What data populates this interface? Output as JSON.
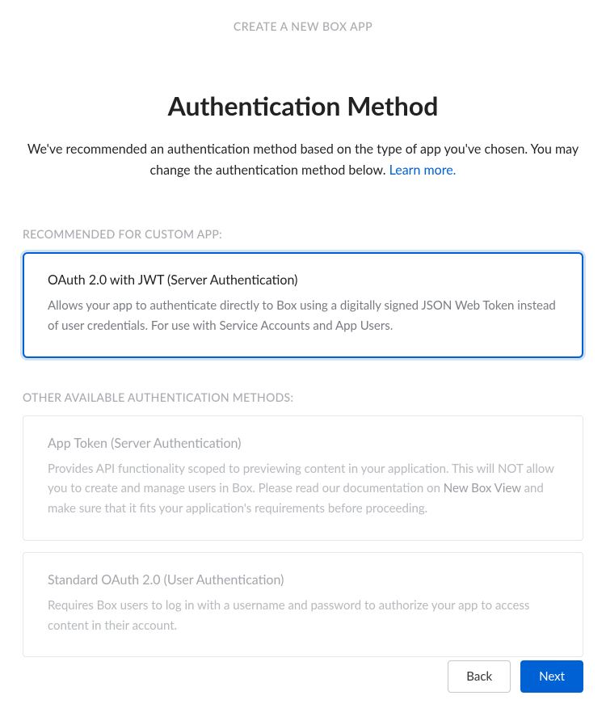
{
  "header": {
    "label": "CREATE A NEW BOX APP"
  },
  "title": "Authentication Method",
  "subtitle": {
    "text": "We've recommended an authentication method based on the type of app you've chosen. You may change the authentication method below. ",
    "link": "Learn more."
  },
  "sections": {
    "recommended_label": "RECOMMENDED FOR CUSTOM APP:",
    "other_label": "OTHER AVAILABLE AUTHENTICATION METHODS:"
  },
  "options": {
    "jwt": {
      "title": "OAuth 2.0 with JWT (Server Authentication)",
      "desc": "Allows your app to authenticate directly to Box using a digitally signed JSON Web Token instead of user credentials. For use with Service Accounts and App Users."
    },
    "app_token": {
      "title": "App Token (Server Authentication)",
      "desc_pre": "Provides API functionality scoped to previewing content in your application. This will NOT allow you to create and manage users in Box. Please read our documentation on ",
      "desc_link": "New Box View",
      "desc_post": " and make sure that it fits your application's requirements before proceeding."
    },
    "oauth": {
      "title": "Standard OAuth 2.0 (User Authentication)",
      "desc": "Requires Box users to log in with a username and password to authorize your app to access content in their account."
    }
  },
  "footer": {
    "back": "Back",
    "next": "Next"
  }
}
